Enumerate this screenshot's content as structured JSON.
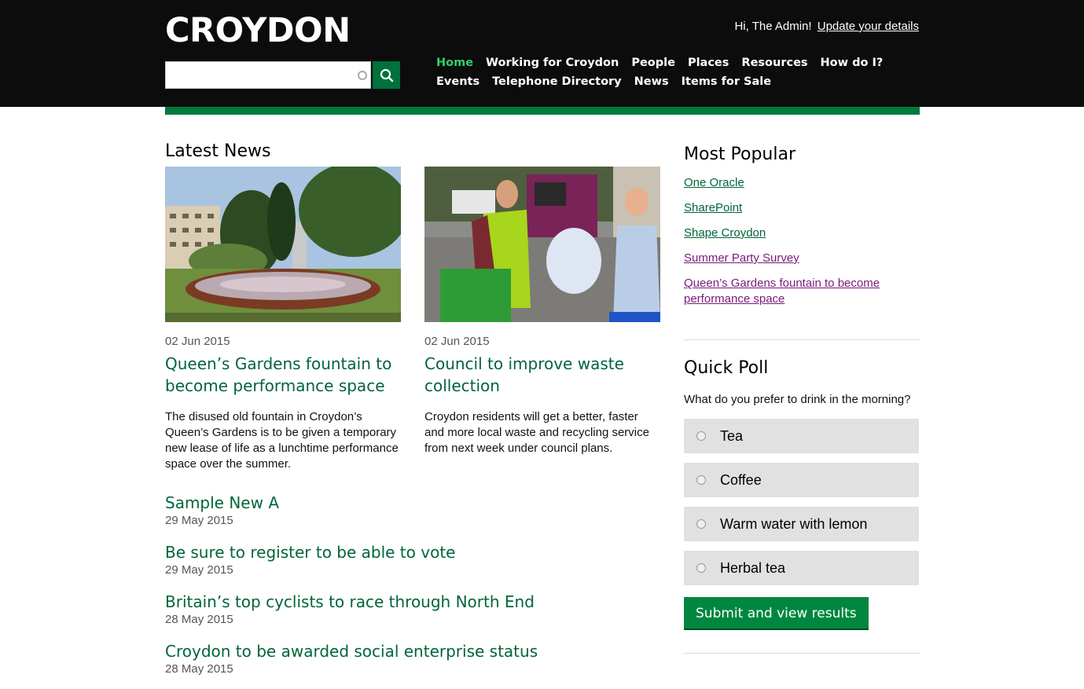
{
  "header": {
    "logo": "CROYDON",
    "greeting": "Hi, The Admin!",
    "update_link": "Update your details",
    "search_placeholder": ""
  },
  "nav": [
    "Home",
    "Working for Croydon",
    "People",
    "Places",
    "Resources",
    "How do I?",
    "Events",
    "Telephone Directory",
    "News",
    "Items for Sale"
  ],
  "latest_news": {
    "title": "Latest News",
    "cards": [
      {
        "date": "02 Jun 2015",
        "title": "Queen’s Gardens fountain to become performance space",
        "desc": "The disused old fountain in Croydon’s Queen’s Gardens is to be given a temporary new lease of life as a lunchtime performance space over the summer."
      },
      {
        "date": "02 Jun 2015",
        "title": "Council to improve waste collection",
        "desc": "Croydon residents will get a better, faster and more local waste and recycling service from next week under council plans."
      }
    ],
    "list": [
      {
        "title": "Sample New A",
        "date": "29 May 2015"
      },
      {
        "title": "Be sure to register to be able to vote",
        "date": "29 May 2015"
      },
      {
        "title": "Britain’s top cyclists to race through North End",
        "date": "28 May 2015"
      },
      {
        "title": "Croydon to be awarded social enterprise status",
        "date": "28 May 2015"
      }
    ]
  },
  "most_popular": {
    "title": "Most Popular",
    "links": [
      "One Oracle",
      "SharePoint",
      "Shape Croydon",
      "Summer Party Survey",
      "Queen’s Gardens fountain to become performance space"
    ]
  },
  "poll": {
    "title": "Quick Poll",
    "question": "What do you prefer to drink in the morning?",
    "options": [
      "Tea",
      "Coffee",
      "Warm water with lemon",
      "Herbal tea"
    ],
    "submit": "Submit and view results"
  },
  "colors": {
    "header_bg": "#0c0c0c",
    "brand_green": "#007a3d",
    "link_green": "#00653a",
    "nav_active": "#2fd06a",
    "visited": "#7a1a7a"
  }
}
